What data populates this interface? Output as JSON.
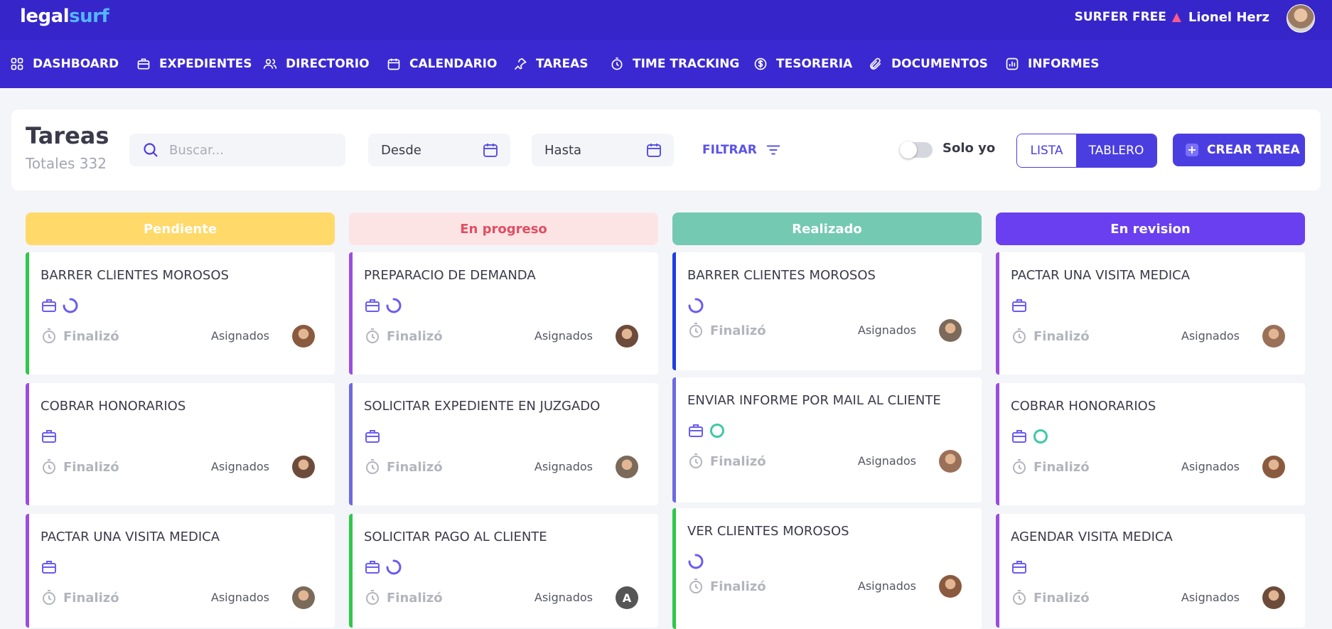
{
  "header": {
    "logo_a": "legal",
    "logo_b": "surf",
    "plan": "SURFER FREE",
    "user_name": "Lionel Herz"
  },
  "nav": [
    {
      "label": "DASHBOARD",
      "icon": "grid-icon"
    },
    {
      "label": "EXPEDIENTES",
      "icon": "briefcase-icon"
    },
    {
      "label": "DIRECTORIO",
      "icon": "users-icon"
    },
    {
      "label": "CALENDARIO",
      "icon": "calendar-icon"
    },
    {
      "label": "TAREAS",
      "icon": "pin-icon"
    },
    {
      "label": "TIME TRACKING",
      "icon": "stopwatch-icon"
    },
    {
      "label": "TESORERIA",
      "icon": "dollar-icon"
    },
    {
      "label": "DOCUMENTOS",
      "icon": "paperclip-icon"
    },
    {
      "label": "INFORMES",
      "icon": "report-icon"
    }
  ],
  "toolbar": {
    "title": "Tareas",
    "total": "Totales 332",
    "search_placeholder": "Buscar...",
    "from": "Desde",
    "to": "Hasta",
    "filter": "FILTRAR",
    "solo_yo": "Solo yo",
    "view_list": "LISTA",
    "view_board": "TABLERO",
    "create": "CREAR TAREA"
  },
  "columns": [
    {
      "name": "Pendiente",
      "color": "#ffd96a",
      "text_color": "#ffffff",
      "cards": [
        {
          "title": "BARRER CLIENTES MOROSOS",
          "status": "Finalizó",
          "assigned": "Asignados",
          "border": "#2ec84a",
          "icons": [
            "briefcase-icon",
            "progress-icon"
          ]
        },
        {
          "title": "COBRAR HONORARIOS",
          "status": "Finalizó",
          "assigned": "Asignados",
          "border": "#9c4de0",
          "icons": [
            "briefcase-icon"
          ]
        },
        {
          "title": "PACTAR UNA VISITA MEDICA",
          "status": "Finalizó",
          "assigned": "Asignados",
          "border": "#9c4de0",
          "icons": [
            "briefcase-icon"
          ]
        }
      ]
    },
    {
      "name": "En progreso",
      "color": "#fde4e4",
      "text_color": "#e04e62",
      "cards": [
        {
          "title": "PREPARACIO DE DEMANDA",
          "status": "Finalizó",
          "assigned": "Asignados",
          "border": "#9c4de0",
          "icons": [
            "briefcase-icon",
            "progress-icon"
          ]
        },
        {
          "title": "SOLICITAR EXPEDIENTE EN JUZGADO",
          "status": "Finalizó",
          "assigned": "Asignados",
          "border": "#6d6ae0",
          "icons": [
            "briefcase-icon"
          ]
        },
        {
          "title": "SOLICITAR PAGO AL CLIENTE",
          "status": "Finalizó",
          "assigned": "Asignados",
          "border": "#2ec84a",
          "icons": [
            "briefcase-icon",
            "progress-icon"
          ],
          "avatar_letter": "A"
        }
      ]
    },
    {
      "name": "Realizado",
      "color": "#74c9b3",
      "text_color": "#ffffff",
      "cards": [
        {
          "title": "BARRER CLIENTES MOROSOS",
          "status": "Finalizó",
          "assigned": "Asignados",
          "border": "#1f3fe0",
          "icons": [
            "progress-icon"
          ]
        },
        {
          "title": "ENVIAR INFORME POR MAIL AL CLIENTE",
          "status": "Finalizó",
          "assigned": "Asignados",
          "border": "#6d6ae0",
          "icons": [
            "briefcase-icon",
            "ring-icon"
          ]
        },
        {
          "title": "VER CLIENTES MOROSOS",
          "status": "Finalizó",
          "assigned": "Asignados",
          "border": "#2ec84a",
          "icons": [
            "progress-icon"
          ]
        }
      ]
    },
    {
      "name": "En revision",
      "color": "#6a3ff0",
      "text_color": "#ffffff",
      "cards": [
        {
          "title": "PACTAR UNA VISITA MEDICA",
          "status": "Finalizó",
          "assigned": "Asignados",
          "border": "#9c4de0",
          "icons": [
            "briefcase-icon"
          ]
        },
        {
          "title": "COBRAR HONORARIOS",
          "status": "Finalizó",
          "assigned": "Asignados",
          "border": "#9c4de0",
          "icons": [
            "briefcase-icon",
            "ring-icon"
          ]
        },
        {
          "title": "AGENDAR VISITA MEDICA",
          "status": "Finalizó",
          "assigned": "Asignados",
          "border": "#9c4de0",
          "icons": [
            "briefcase-icon"
          ]
        }
      ]
    }
  ]
}
